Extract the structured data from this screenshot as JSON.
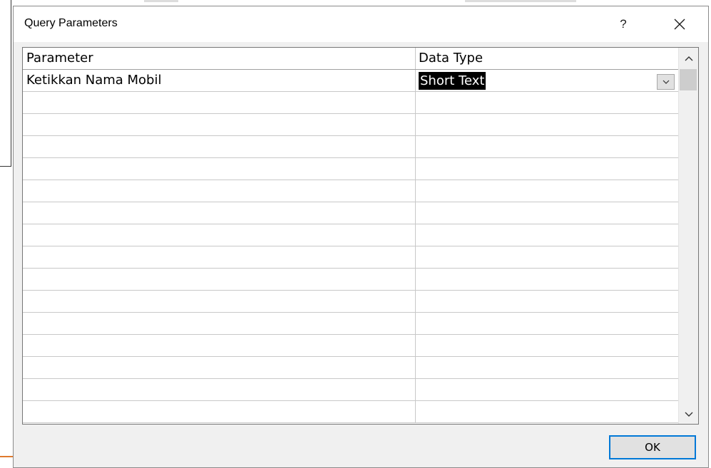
{
  "dialog": {
    "title": "Query Parameters",
    "help_label": "?"
  },
  "table": {
    "columns": [
      "Parameter",
      "Data Type"
    ],
    "rows": [
      {
        "parameter": "Ketikkan Nama Mobil",
        "data_type": "Short Text"
      }
    ],
    "empty_rows": 15
  },
  "icons": {
    "close": "close-icon",
    "dropdown": "chevron-down-icon",
    "scroll_up": "chevron-up-icon",
    "scroll_down": "chevron-down-icon"
  },
  "buttons": {
    "ok_label": "OK"
  },
  "colors": {
    "selection_bg": "#000000",
    "selection_text": "#ffffff",
    "focus_border": "#0078d7",
    "dialog_bg": "#f0f0f0",
    "background_accent": "#e07a2e"
  }
}
